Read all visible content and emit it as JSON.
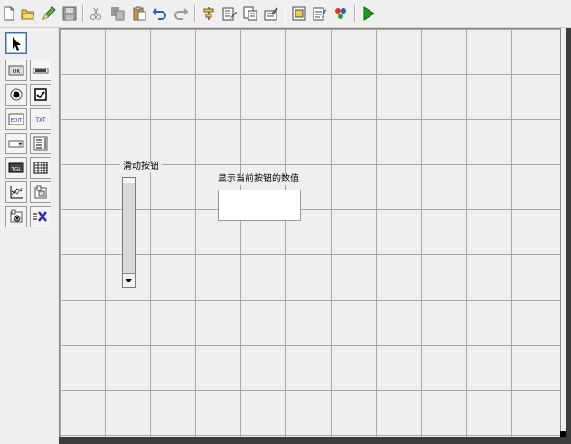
{
  "toolbar": {
    "buttons": [
      "new-file",
      "open-file",
      "edit",
      "save",
      "cut",
      "copy",
      "paste",
      "undo",
      "redo",
      "align",
      "property-editor",
      "tab-order",
      "menu-editor",
      "object-browser",
      "m-file-editor",
      "color",
      "run"
    ]
  },
  "palette": {
    "tools": [
      "select",
      "push-button",
      "slider",
      "radio-button",
      "checkbox",
      "edit-text",
      "static-text",
      "popup-menu",
      "listbox",
      "toggle-button",
      "table",
      "axes",
      "panel",
      "button-group",
      "activex"
    ],
    "labels": {
      "push_button": "OK",
      "edit_text": "EDIT",
      "static_text": "TXT",
      "toggle_button": "TGL"
    }
  },
  "canvas": {
    "slider_label": "滑动按钮",
    "static_text": "显示当前按钮的数值",
    "edit_value": ""
  },
  "colors": {
    "run": "#1e9e1e",
    "select_border": "#3a6ea5"
  }
}
